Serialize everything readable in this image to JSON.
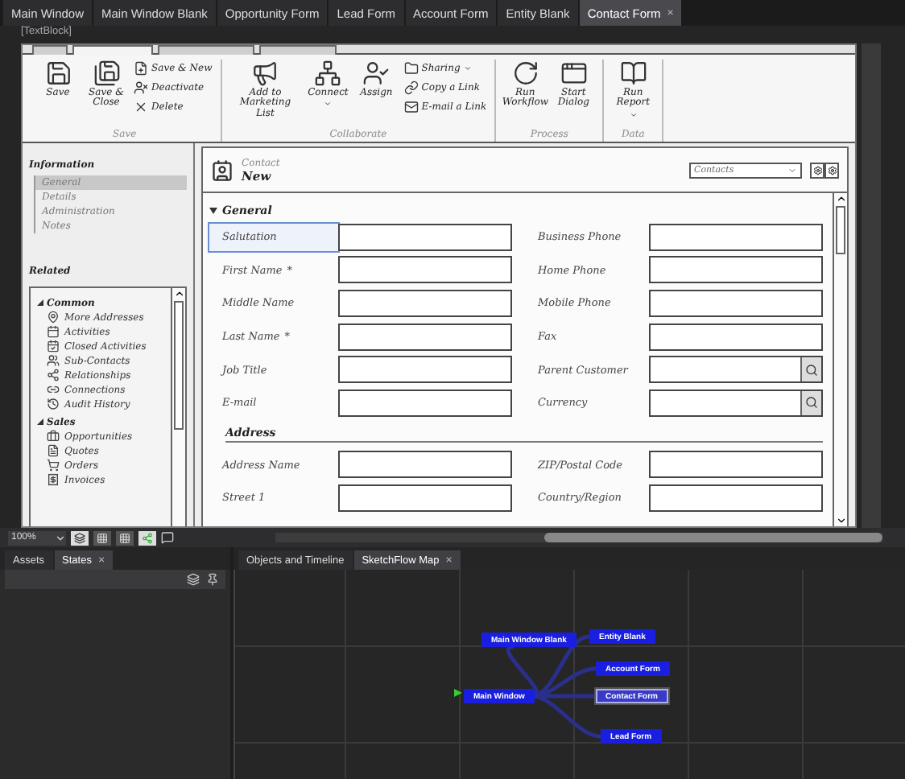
{
  "doc_tabs": [
    {
      "label": "Main Window",
      "selected": false
    },
    {
      "label": "Main Window Blank",
      "selected": false
    },
    {
      "label": "Opportunity Form",
      "selected": false
    },
    {
      "label": "Lead Form",
      "selected": false
    },
    {
      "label": "Account Form",
      "selected": false
    },
    {
      "label": "Entity Blank",
      "selected": false
    },
    {
      "label": "Contact Form",
      "selected": true,
      "close": "×"
    }
  ],
  "element_label": "[TextBlock]",
  "ribbon": {
    "tabs": [
      {
        "selected": false
      },
      {
        "selected": true
      },
      {
        "selected": false
      },
      {
        "selected": false
      }
    ],
    "groups": [
      {
        "label": "Save",
        "buttons": [
          {
            "label": "Save",
            "kind": "large"
          },
          {
            "label": "Save & Close",
            "kind": "large"
          },
          {
            "label": "Save & New",
            "kind": "small"
          },
          {
            "label": "Deactivate",
            "kind": "small"
          },
          {
            "label": "Delete",
            "kind": "small"
          }
        ]
      },
      {
        "label": "Collaborate",
        "buttons": [
          {
            "label": "Add to Marketing List",
            "kind": "large"
          },
          {
            "label": "Connect",
            "kind": "large",
            "dropdown": true
          },
          {
            "label": "Assign",
            "kind": "large"
          },
          {
            "label": "Sharing",
            "kind": "small",
            "dropdown": true
          },
          {
            "label": "Copy a Link",
            "kind": "small"
          },
          {
            "label": "E-mail a Link",
            "kind": "small"
          }
        ]
      },
      {
        "label": "Process",
        "buttons": [
          {
            "label": "Run Workflow",
            "kind": "large"
          },
          {
            "label": "Start Dialog",
            "kind": "large"
          }
        ]
      },
      {
        "label": "Data",
        "buttons": [
          {
            "label": "Run Report",
            "kind": "large",
            "dropdown": true
          }
        ]
      }
    ]
  },
  "nav": {
    "information": {
      "title": "Information",
      "items": [
        {
          "label": "General",
          "selected": true
        },
        {
          "label": "Details",
          "selected": false
        },
        {
          "label": "Administration",
          "selected": false
        },
        {
          "label": "Notes",
          "selected": false
        }
      ]
    },
    "related": {
      "title": "Related",
      "sections": [
        {
          "title": "Common",
          "expanded": true,
          "items": [
            "More Addresses",
            "Activities",
            "Closed Activities",
            "Sub-Contacts",
            "Relationships",
            "Connections",
            "Audit History"
          ]
        },
        {
          "title": "Sales",
          "expanded": true,
          "items": [
            "Opportunities",
            "Quotes",
            "Orders",
            "Invoices"
          ]
        }
      ]
    }
  },
  "form": {
    "entity": "Contact",
    "title": "New",
    "view_selector": "Contacts",
    "sections": [
      {
        "title": "General",
        "kind": "section",
        "rows": [
          [
            {
              "label": "Salutation",
              "selected": true
            },
            {
              "label": "Business Phone"
            }
          ],
          [
            {
              "label": "First Name",
              "required": "*"
            },
            {
              "label": "Home Phone"
            }
          ],
          [
            {
              "label": "Middle Name"
            },
            {
              "label": "Mobile Phone"
            }
          ],
          [
            {
              "label": "Last Name",
              "required": "*"
            },
            {
              "label": "Fax"
            }
          ],
          [
            {
              "label": "Job Title"
            },
            {
              "label": "Parent Customer",
              "lookup": true
            }
          ],
          [
            {
              "label": "E-mail"
            },
            {
              "label": "Currency",
              "lookup": true
            }
          ]
        ]
      },
      {
        "title": "Address",
        "kind": "subsection",
        "rows": [
          [
            {
              "label": "Address Name"
            },
            {
              "label": "ZIP/Postal Code"
            }
          ],
          [
            {
              "label": "Street 1"
            },
            {
              "label": "Country/Region"
            }
          ]
        ]
      }
    ]
  },
  "zoom": "100%",
  "left_panel": {
    "tabs": [
      {
        "label": "Assets",
        "selected": false
      },
      {
        "label": "States",
        "selected": true,
        "close": "×"
      }
    ]
  },
  "right_panel": {
    "tabs": [
      {
        "label": "Objects and Timeline",
        "selected": false
      },
      {
        "label": "SketchFlow Map",
        "selected": true,
        "close": "×"
      }
    ],
    "map_nodes": [
      {
        "label": "Main Window Blank",
        "selected": false,
        "start": false
      },
      {
        "label": "Entity Blank",
        "selected": false,
        "start": false
      },
      {
        "label": "Account Form",
        "selected": false,
        "start": false
      },
      {
        "label": "Main Window",
        "selected": false,
        "start": true
      },
      {
        "label": "Contact Form",
        "selected": true,
        "start": false
      },
      {
        "label": "Lead Form",
        "selected": false,
        "start": false
      }
    ]
  }
}
